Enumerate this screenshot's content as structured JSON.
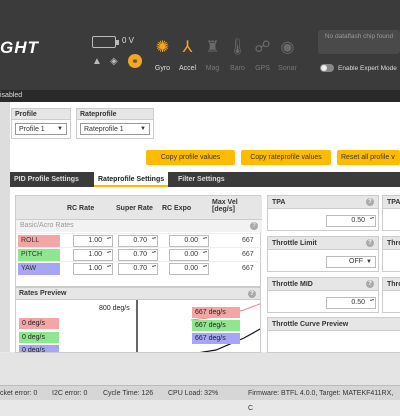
{
  "header": {
    "logo": "GHT",
    "voltage": "0 V",
    "sensors": [
      {
        "name": "Gyro",
        "icon": "gyro-icon",
        "on": true,
        "glyph": "✺"
      },
      {
        "name": "Accel",
        "icon": "accel-icon",
        "on": true,
        "glyph": "⅄"
      },
      {
        "name": "Mag",
        "icon": "mag-icon",
        "on": false,
        "glyph": "♜"
      },
      {
        "name": "Baro",
        "icon": "baro-icon",
        "on": false,
        "glyph": "🌡"
      },
      {
        "name": "GPS",
        "icon": "gps-icon",
        "on": false,
        "glyph": "☍"
      },
      {
        "name": "Sonar",
        "icon": "sonar-icon",
        "on": false,
        "glyph": "◉"
      }
    ],
    "dataflash": "No dataflash chip found",
    "expert_mode": "Enable Expert Mode",
    "status_strip": "isabled"
  },
  "profile": {
    "label": "Profile",
    "value": "Profile 1"
  },
  "rateprofile": {
    "label": "Rateprofile",
    "value": "Rateprofile 1"
  },
  "actions": {
    "copy_profile": "Copy profile values",
    "copy_rateprofile": "Copy rateprofile values",
    "reset_all": "Reset all profile v"
  },
  "tabs": [
    {
      "label": "PID Profile Settings",
      "active": false
    },
    {
      "label": "Rateprofile Settings",
      "active": true
    },
    {
      "label": "Filter Settings",
      "active": false
    }
  ],
  "rates_table": {
    "headers": {
      "rc_rate": "RC Rate",
      "super_rate": "Super Rate",
      "rc_expo": "RC Expo",
      "max_vel": "Max Vel [deg/s]"
    },
    "subheader": "Basic/Acro Rates",
    "rows": [
      {
        "axis": "ROLL",
        "color": "#f4a6a6",
        "rc_rate": "1.00",
        "super_rate": "0.70",
        "rc_expo": "0.00",
        "max_vel": "667"
      },
      {
        "axis": "PITCH",
        "color": "#8ee68e",
        "rc_rate": "1.00",
        "super_rate": "0.70",
        "rc_expo": "0.00",
        "max_vel": "667"
      },
      {
        "axis": "YAW",
        "color": "#a6a6f4",
        "rc_rate": "1.00",
        "super_rate": "0.70",
        "rc_expo": "0.00",
        "max_vel": "667"
      }
    ]
  },
  "rates_preview": {
    "title": "Rates Preview",
    "top_label": "800 deg/s",
    "left_tags": [
      "0 deg/s",
      "0 deg/s",
      "0 deg/s"
    ],
    "right_tags": [
      "667 deg/s",
      "667 deg/s",
      "667 deg/s"
    ]
  },
  "tpa": {
    "title": "TPA",
    "value": "0.50",
    "title2": "TPA"
  },
  "throttle_limit": {
    "title": "Throttle Limit",
    "value": "OFF",
    "title2": "Thro"
  },
  "throttle_mid": {
    "title": "Throttle MID",
    "value": "0.50",
    "title2": "Thro"
  },
  "throttle_curve": {
    "title": "Throttle Curve Preview"
  },
  "bottom": {
    "packet_error": "cket error: 0",
    "i2c_error": "I2C error: 0",
    "cycle_time": "Cycle Time: 126",
    "cpu_load": "CPU Load: 32%",
    "firmware": "Firmware: BTFL 4.0.0, Target: MATEKF411RX, C"
  },
  "colors": {
    "accent": "#ffbb00",
    "header_bg": "#3b3b3b",
    "sensor_on": "#f5a623"
  }
}
